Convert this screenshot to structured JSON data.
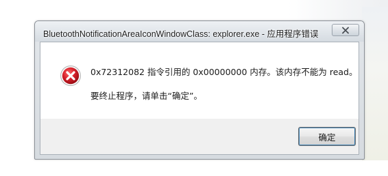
{
  "window": {
    "title": "BluetoothNotificationAreaIconWindowClass: explorer.exe - 应用程序错误"
  },
  "titlebar": {
    "close_icon": "close-x-icon"
  },
  "message": {
    "icon": "error-icon",
    "line1": "0x72312082 指令引用的 0x00000000 内存。该内存不能为 read。",
    "line2": "要终止程序，请单击“确定”。"
  },
  "buttons": {
    "ok_label": "确定"
  },
  "colors": {
    "error_red": "#d6202a",
    "focus_border": "#3c7fb1"
  }
}
